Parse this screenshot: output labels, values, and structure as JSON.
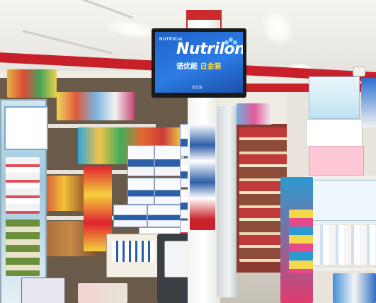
{
  "scene": {
    "description_label": "",
    "monitor": {
      "brand_small": "NUTRICIA",
      "brand": "Nutrilon",
      "tagline_part1": "诺优能",
      "tagline_part2": "日金装",
      "footer": "诺优能"
    }
  },
  "colors": {
    "accent_red": "#c8202a",
    "screen_blue": "#2c7ce5",
    "highlight_yellow": "#ffd83a"
  }
}
